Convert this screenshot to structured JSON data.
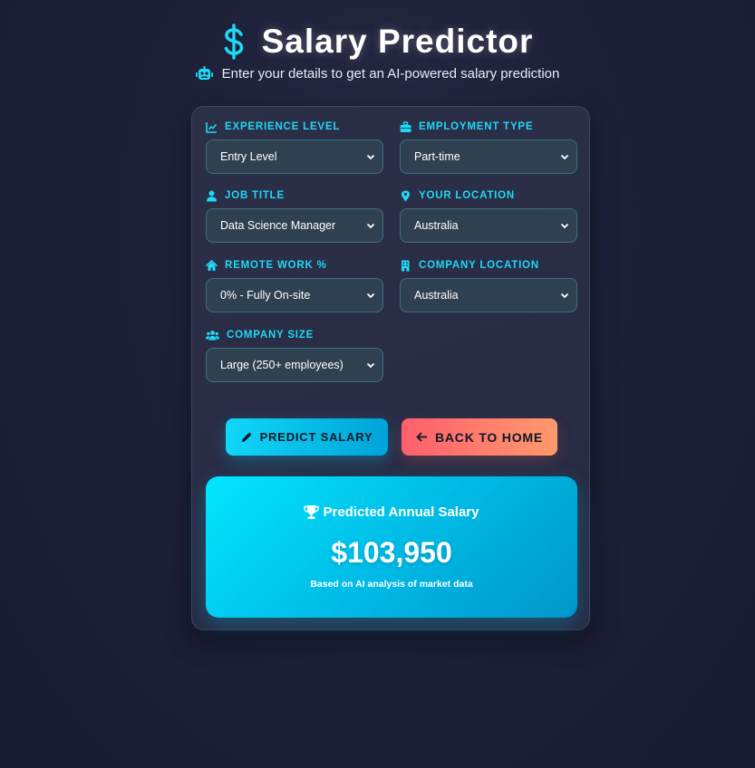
{
  "header": {
    "title": "Salary Predictor",
    "subtitle": "Enter your details to get an AI-powered salary prediction",
    "title_icon": "dollar-icon",
    "subtitle_icon": "robot-icon"
  },
  "form": {
    "experience": {
      "label": "EXPERIENCE LEVEL",
      "value": "Entry Level",
      "icon": "chart-line-icon"
    },
    "employment": {
      "label": "EMPLOYMENT TYPE",
      "value": "Part-time",
      "icon": "briefcase-icon"
    },
    "job_title": {
      "label": "JOB TITLE",
      "value": "Data Science Manager",
      "icon": "user-icon"
    },
    "location": {
      "label": "YOUR LOCATION",
      "value": "Australia",
      "icon": "map-pin-icon"
    },
    "remote": {
      "label": "REMOTE WORK %",
      "value": "0% - Fully On-site",
      "icon": "home-icon"
    },
    "company_location": {
      "label": "COMPANY LOCATION",
      "value": "Australia",
      "icon": "building-icon"
    },
    "company_size": {
      "label": "COMPANY SIZE",
      "value": "Large (250+ employees)",
      "icon": "users-icon"
    }
  },
  "buttons": {
    "predict": "PREDICT SALARY",
    "back": "BACK TO HOME"
  },
  "result": {
    "heading": "Predicted Annual Salary",
    "value": "$103,950",
    "note": "Based on AI analysis of market data"
  },
  "colors": {
    "accent": "#1ed8f5",
    "background": "#1d2038",
    "card": "#2a2d46",
    "back_button_start": "#ff5f6d",
    "back_button_end": "#ff9a6b"
  }
}
